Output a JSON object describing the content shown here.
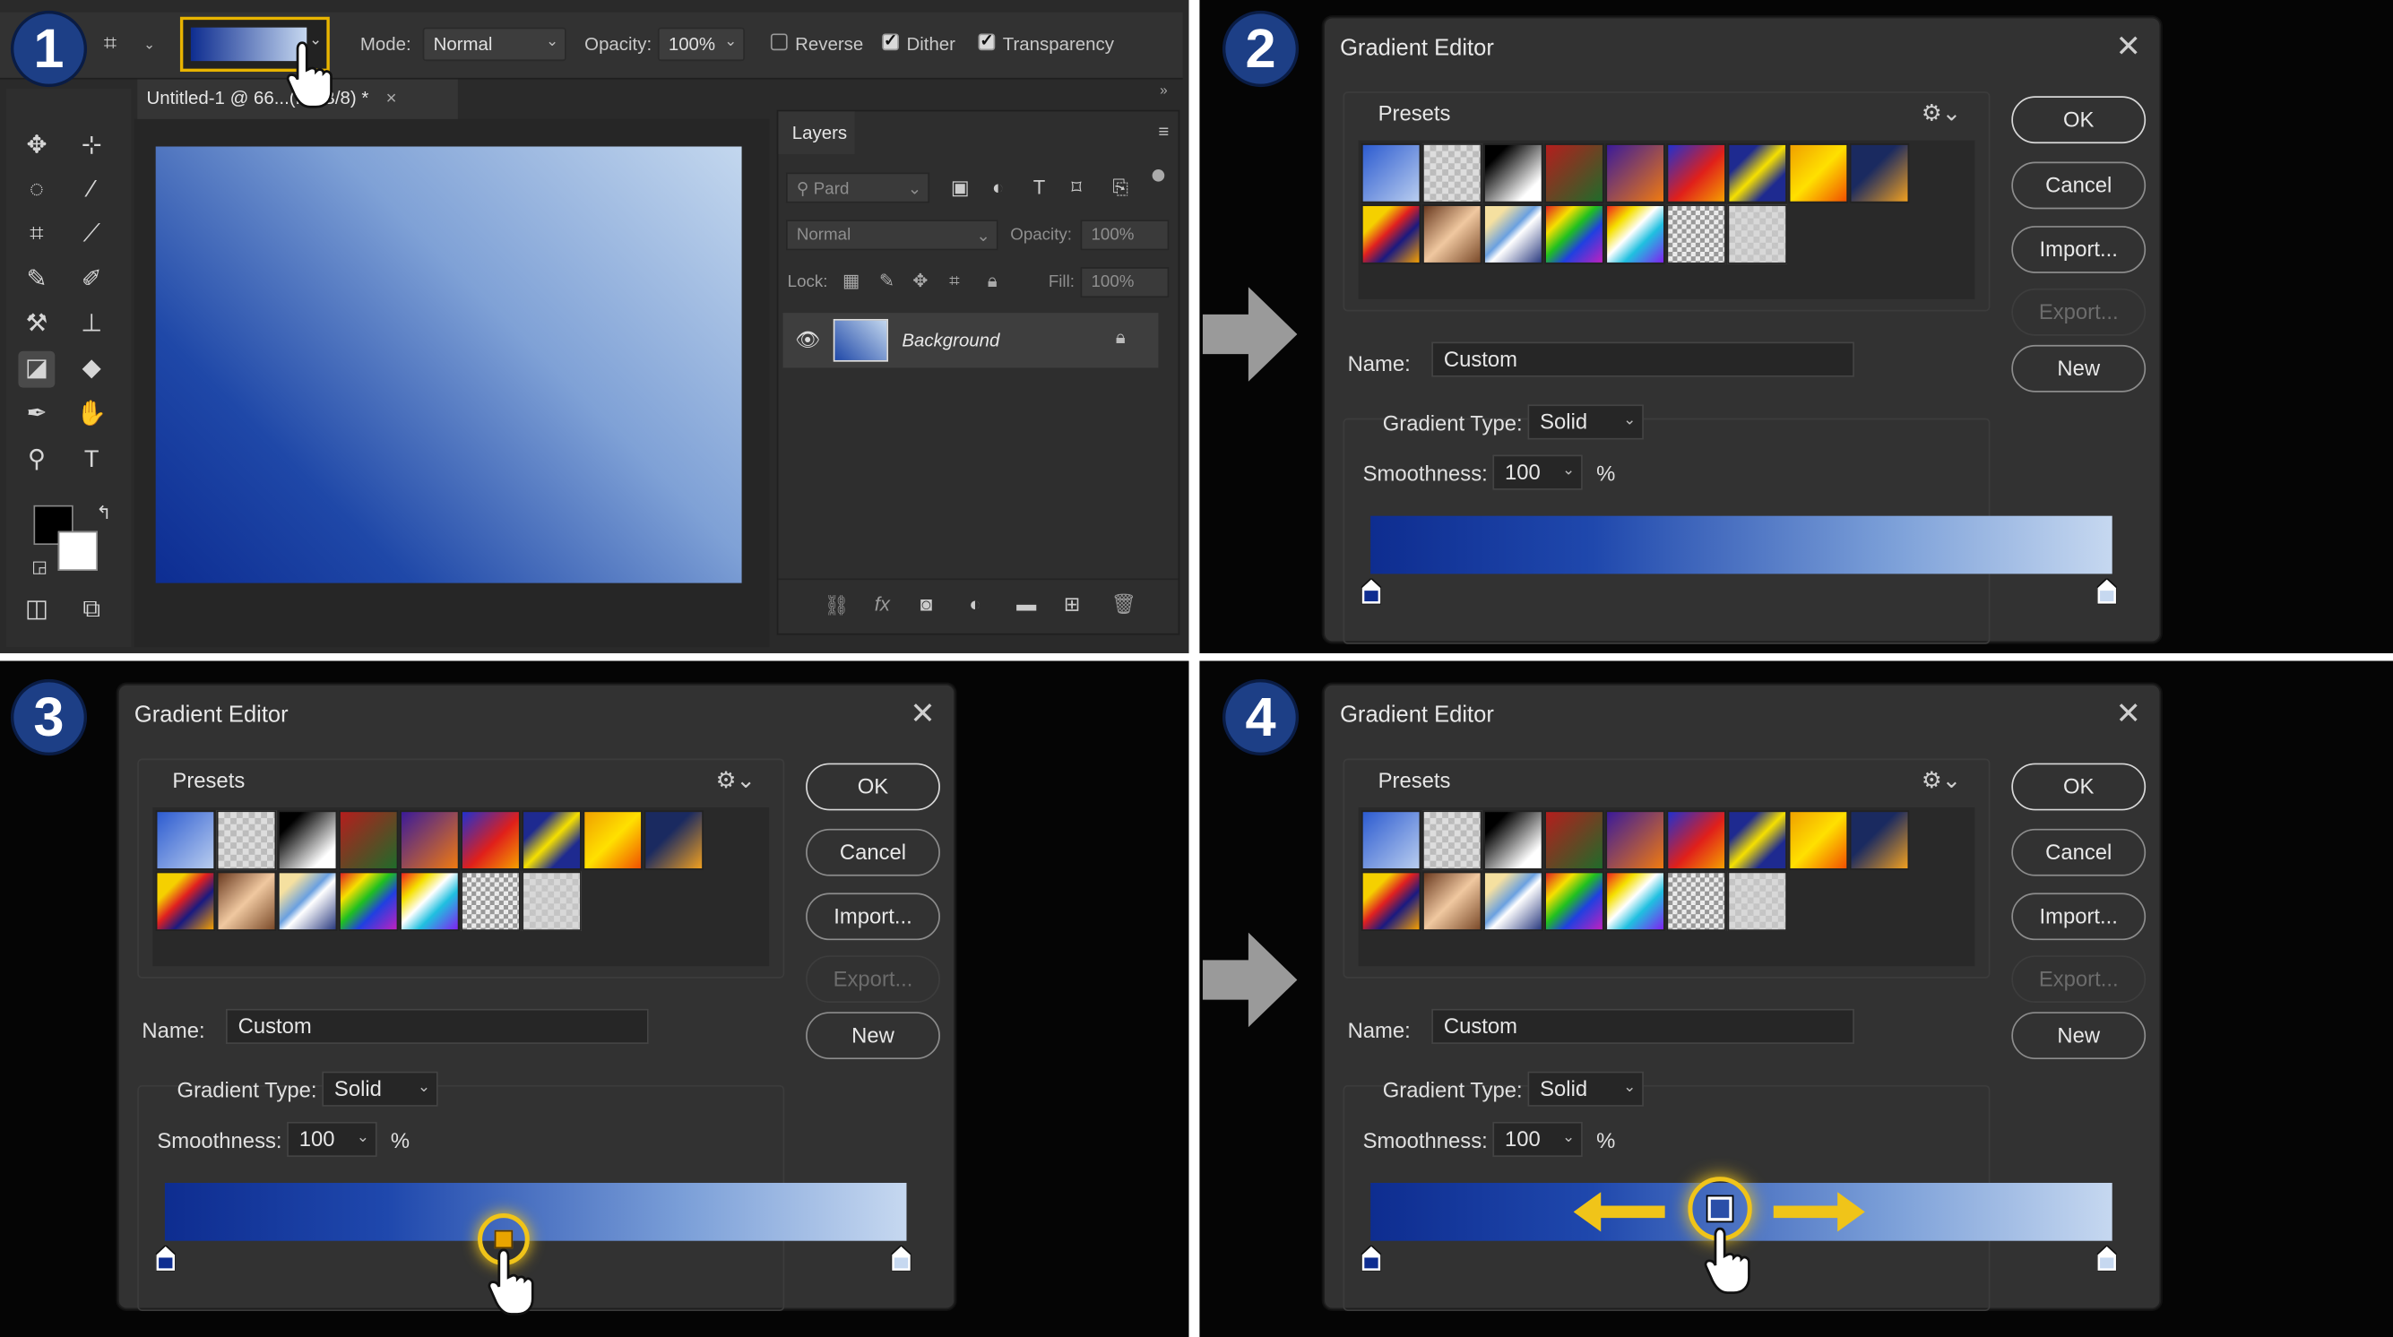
{
  "steps": [
    "1",
    "2",
    "3",
    "4"
  ],
  "photoshop": {
    "options_bar": {
      "mode_label": "Mode:",
      "mode_value": "Normal",
      "opacity_label": "Opacity:",
      "opacity_value": "100%",
      "reverse_label": "Reverse",
      "reverse_checked": false,
      "dither_label": "Dither",
      "dither_checked": true,
      "transparency_label": "Transparency",
      "transparency_checked": true
    },
    "document_tab": "Untitled-1 @ 66...(RGB/8) *",
    "layers_panel": {
      "tab": "Layers",
      "filter_placeholder": "Pard",
      "blend_mode": "Normal",
      "opacity_label": "Opacity:",
      "opacity_value": "100%",
      "lock_label": "Lock:",
      "fill_label": "Fill:",
      "fill_value": "100%",
      "layer_name": "Background"
    }
  },
  "dialog": {
    "title": "Gradient Editor",
    "presets_label": "Presets",
    "buttons": {
      "ok": "OK",
      "cancel": "Cancel",
      "import": "Import...",
      "export": "Export...",
      "new": "New"
    },
    "name_label": "Name:",
    "name_value": "Custom",
    "gradient_type_label": "Gradient Type:",
    "gradient_type_value": "Solid",
    "smoothness_label": "Smoothness:",
    "smoothness_value": "100",
    "smoothness_unit": "%"
  },
  "colors": {
    "gradient_start": "#0e2d90",
    "gradient_end": "#c6d8f0",
    "highlight": "#f0c419",
    "badge": "#1d3f86"
  }
}
